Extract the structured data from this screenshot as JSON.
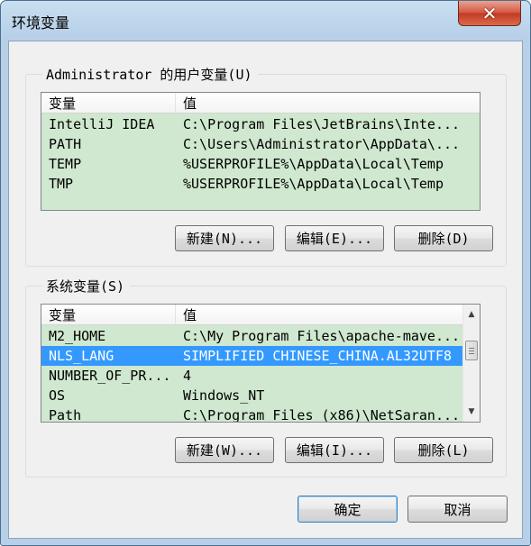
{
  "window": {
    "title": "环境变量",
    "close_icon": "close-icon"
  },
  "user_vars": {
    "legend": "Administrator 的用户变量(U)",
    "columns": [
      "变量",
      "值"
    ],
    "rows": [
      {
        "name": "IntelliJ IDEA",
        "value": "C:\\Program Files\\JetBrains\\Inte..."
      },
      {
        "name": "PATH",
        "value": "C:\\Users\\Administrator\\AppData\\..."
      },
      {
        "name": "TEMP",
        "value": "%USERPROFILE%\\AppData\\Local\\Temp"
      },
      {
        "name": "TMP",
        "value": "%USERPROFILE%\\AppData\\Local\\Temp"
      }
    ],
    "buttons": {
      "new": "新建(N)...",
      "edit": "编辑(E)...",
      "delete": "删除(D)"
    }
  },
  "system_vars": {
    "legend": "系统变量(S)",
    "columns": [
      "变量",
      "值"
    ],
    "rows": [
      {
        "name": "M2_HOME",
        "value": "C:\\My Program Files\\apache-mave..."
      },
      {
        "name": "NLS_LANG",
        "value": "SIMPLIFIED CHINESE_CHINA.AL32UTF8",
        "selected": true
      },
      {
        "name": "NUMBER_OF_PR...",
        "value": "4"
      },
      {
        "name": "OS",
        "value": "Windows_NT"
      },
      {
        "name": "Path",
        "value": "C:\\Program Files (x86)\\NetSaran..."
      }
    ],
    "buttons": {
      "new": "新建(W)...",
      "edit": "编辑(I)...",
      "delete": "删除(L)"
    }
  },
  "footer": {
    "ok": "确定",
    "cancel": "取消"
  }
}
